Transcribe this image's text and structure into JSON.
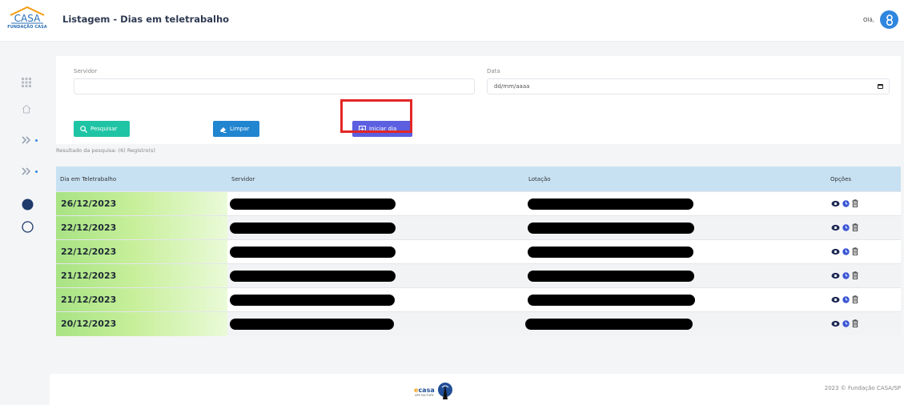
{
  "header": {
    "logo_text": "FUNDAÇÃO CASA",
    "title": "Listagem - Dias em teletrabalho",
    "greeting": "Olá,",
    "avatar_letter": "8",
    "accent_color": "#2e86de"
  },
  "sidebar": {
    "items": [
      {
        "icon": "grid-icon"
      },
      {
        "icon": "home-icon"
      },
      {
        "icon": "double-chevron-icon"
      },
      {
        "icon": "double-chevron-icon"
      },
      {
        "icon": "filled-circle-icon"
      },
      {
        "icon": "outline-circle-icon"
      }
    ]
  },
  "filters": {
    "servidor_label": "Servidor",
    "servidor_value": "",
    "data_label": "Data",
    "data_placeholder": "dd/mm/aaaa",
    "search_label": "Pesquisar",
    "clear_label": "Limpar",
    "start_label": "Iniciar dia"
  },
  "result_text": "Resultado da pesquisa: (6) Registro(s)",
  "table": {
    "columns": [
      "Dia em Teletrabalho",
      "Servidor",
      "Lotação",
      "Opções"
    ],
    "rows": [
      {
        "date": "26/12/2023"
      },
      {
        "date": "22/12/2023"
      },
      {
        "date": "22/12/2023"
      },
      {
        "date": "21/12/2023"
      },
      {
        "date": "21/12/2023"
      },
      {
        "date": "20/12/2023"
      }
    ]
  },
  "footer": {
    "brand": "ecasa",
    "brand_sub": "APP FACTORY",
    "copyright": "2023 © Fundação CASA/SP"
  }
}
